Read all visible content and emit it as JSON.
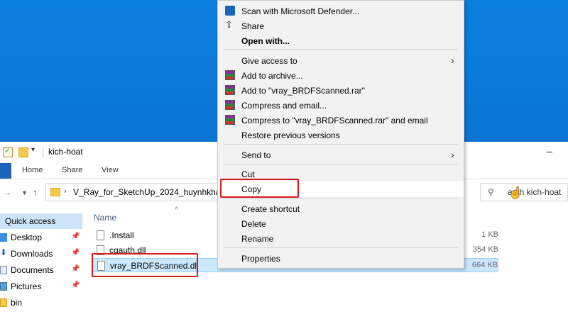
{
  "window": {
    "title": "kich-hoat",
    "minimize": "–"
  },
  "ribbon": {
    "tabs": [
      "Home",
      "Share",
      "View"
    ]
  },
  "address": {
    "path": "V_Ray_for_SketchUp_2024_huynhkhang.c",
    "search_text": "arch kich-hoat"
  },
  "nav_pane": {
    "items": [
      {
        "label": "Quick access",
        "icon": "star-icon"
      },
      {
        "label": "Desktop",
        "icon": "desktop-icon",
        "pinned": true
      },
      {
        "label": "Downloads",
        "icon": "download-icon",
        "pinned": true
      },
      {
        "label": "Documents",
        "icon": "documents-icon",
        "pinned": true
      },
      {
        "label": "Pictures",
        "icon": "pictures-icon",
        "pinned": true
      },
      {
        "label": "bin",
        "icon": "folder-icon",
        "pinned": false
      }
    ]
  },
  "file_list": {
    "column_name": "Name",
    "rows": [
      {
        "name": ".Install",
        "size": "1 KB"
      },
      {
        "name": "cgauth.dll",
        "size": "354 KB"
      },
      {
        "name": "vray_BRDFScanned.dll",
        "size": "664 KB",
        "selected": true
      }
    ]
  },
  "context_menu": {
    "items": [
      {
        "label": "Scan with Microsoft Defender...",
        "icon": "defender-icon"
      },
      {
        "label": "Share",
        "icon": "share-icon"
      },
      {
        "label": "Open with...",
        "bold": true
      },
      {
        "label": "Give access to",
        "submenu": true
      },
      {
        "label": "Add to archive...",
        "icon": "winrar-icon"
      },
      {
        "label": "Add to \"vray_BRDFScanned.rar\"",
        "icon": "winrar-icon"
      },
      {
        "label": "Compress and email...",
        "icon": "winrar-icon"
      },
      {
        "label": "Compress to \"vray_BRDFScanned.rar\" and email",
        "icon": "winrar-icon"
      },
      {
        "label": "Restore previous versions"
      },
      {
        "label": "Send to",
        "submenu": true
      },
      {
        "label": "Cut"
      },
      {
        "label": "Copy",
        "highlighted": true
      },
      {
        "label": "Create shortcut"
      },
      {
        "label": "Delete"
      },
      {
        "label": "Rename"
      },
      {
        "label": "Properties"
      }
    ]
  },
  "colors": {
    "desktop": "#0a78d7",
    "highlight_border": "#d21a1a",
    "selection": "#cce8ff"
  }
}
